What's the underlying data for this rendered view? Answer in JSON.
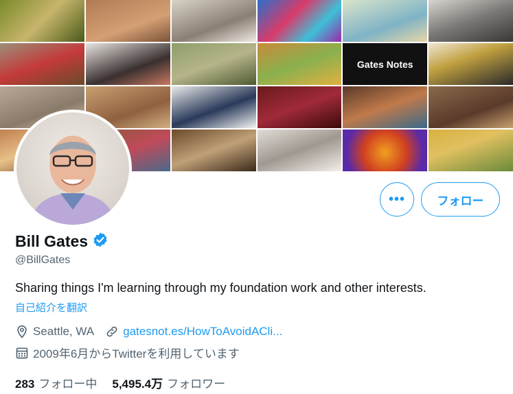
{
  "profile": {
    "name": "Bill Gates",
    "handle": "@BillGates",
    "bio": "Sharing things I'm learning through my foundation work and other interests.",
    "translate_label": "自己紹介を翻訳",
    "location": "Seattle, WA",
    "link": "gatesnot.es/HowToAvoidACli...",
    "joined": "2009年6月からTwitterを利用しています"
  },
  "actions": {
    "more_label": "•••",
    "follow_label": "フォロー"
  },
  "stats": {
    "following_count": "283",
    "following_label": "フォロー中",
    "followers_count": "5,495.4万",
    "followers_label": "フォロワー"
  },
  "banner": {
    "gates_notes_text": "Gates Notes"
  },
  "colors": {
    "accent": "#1d9bf0",
    "muted": "#536471",
    "text": "#0f1419"
  },
  "icons": [
    "verified-badge-icon",
    "location-pin-icon",
    "link-icon",
    "calendar-icon"
  ]
}
